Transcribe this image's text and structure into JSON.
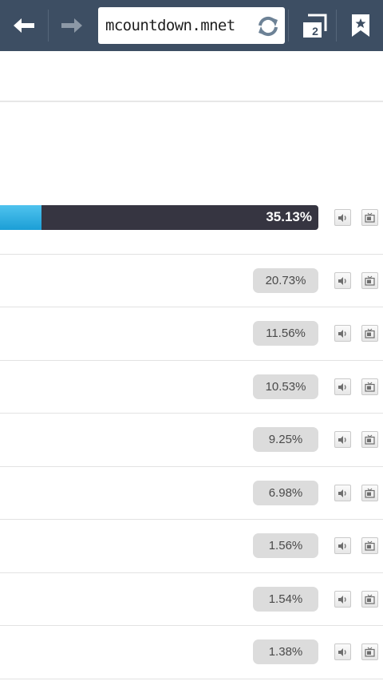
{
  "browser": {
    "url": "mcountdown.mnet",
    "tab_count": "2",
    "icons": {
      "back": "back-arrow-icon",
      "forward": "forward-arrow-icon",
      "reload": "reload-icon",
      "tabs": "tabs-icon",
      "bookmark": "bookmark-star-icon"
    }
  },
  "votes": {
    "top": {
      "label": "35.13%",
      "fill_fraction": 0.1313
    },
    "rows": [
      {
        "label": "20.73%"
      },
      {
        "label": "11.56%"
      },
      {
        "label": "10.53%"
      },
      {
        "label": "9.25%"
      },
      {
        "label": "6.98%"
      },
      {
        "label": "1.56%"
      },
      {
        "label": "1.54%"
      },
      {
        "label": "1.38%"
      }
    ]
  },
  "colors": {
    "toolbar": "#3d4e63",
    "bar_fill": "#1b9ed6",
    "bar_track": "#363541",
    "pill": "#dcdcdc"
  }
}
